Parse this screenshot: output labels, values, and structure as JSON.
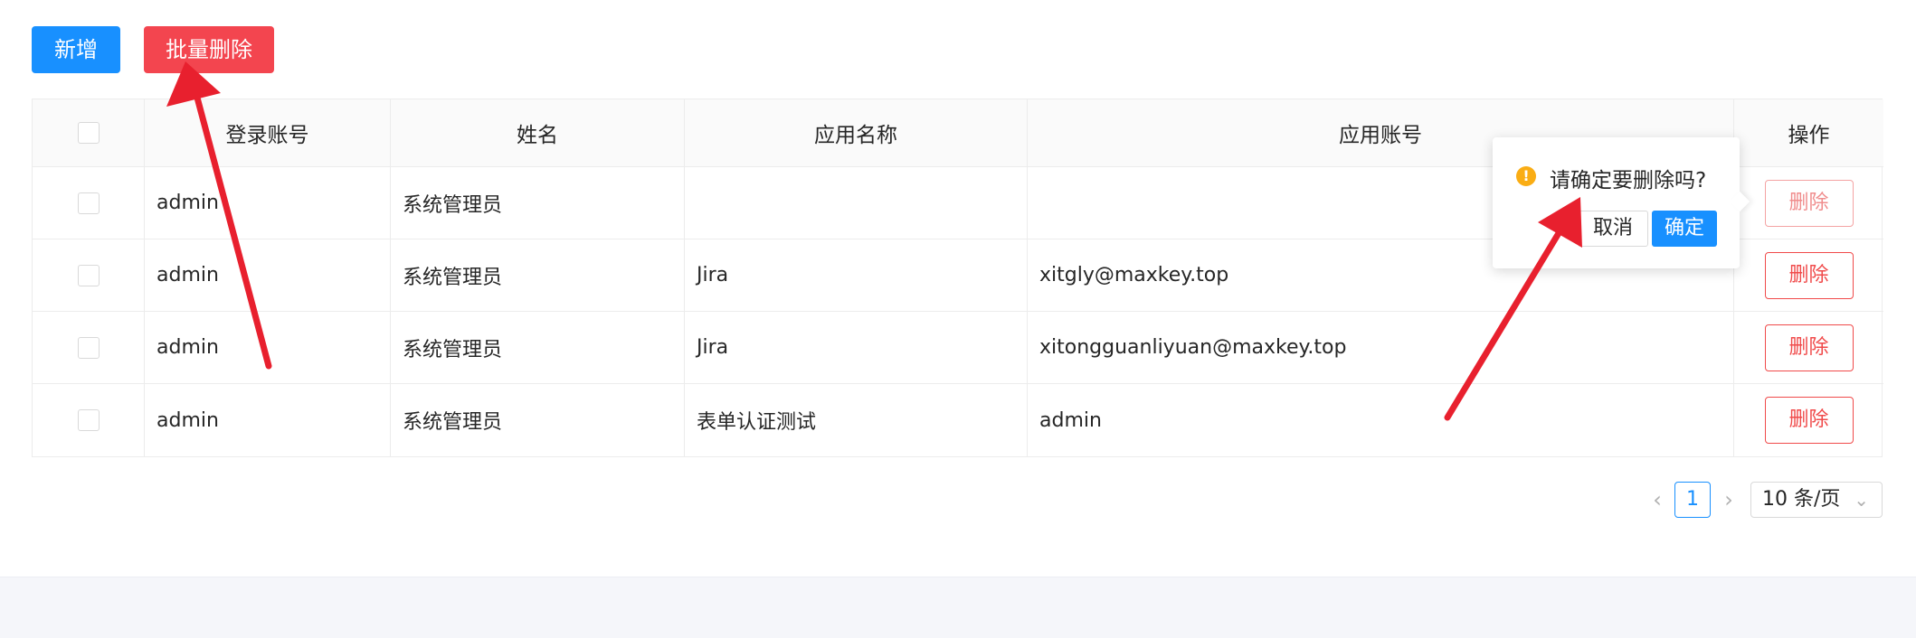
{
  "toolbar": {
    "add_label": "新增",
    "bulk_delete_label": "批量删除"
  },
  "table": {
    "headers": {
      "username": "登录账号",
      "name": "姓名",
      "app_name": "应用名称",
      "app_account": "应用账号",
      "actions": "操作"
    },
    "rows": [
      {
        "username": "admin",
        "name": "系统管理员",
        "app_name": "",
        "app_account": "",
        "action": "删除"
      },
      {
        "username": "admin",
        "name": "系统管理员",
        "app_name": "Jira",
        "app_account": "xitgly@maxkey.top",
        "action": "删除"
      },
      {
        "username": "admin",
        "name": "系统管理员",
        "app_name": "Jira",
        "app_account": "xitongguanliyuan@maxkey.top",
        "action": "删除"
      },
      {
        "username": "admin",
        "name": "系统管理员",
        "app_name": "表单认证测试",
        "app_account": "admin",
        "action": "删除"
      }
    ]
  },
  "popconfirm": {
    "icon": "exclamation-circle-icon",
    "message": "请确定要删除吗?",
    "cancel_label": "取消",
    "ok_label": "确定"
  },
  "pagination": {
    "prev_icon": "chevron-left-icon",
    "current_page": "1",
    "next_icon": "chevron-right-icon",
    "page_size": "10 条/页"
  },
  "colors": {
    "primary": "#1890ff",
    "danger": "#f3454f",
    "annotation_arrow": "#e8202e",
    "warning": "#faad14"
  }
}
